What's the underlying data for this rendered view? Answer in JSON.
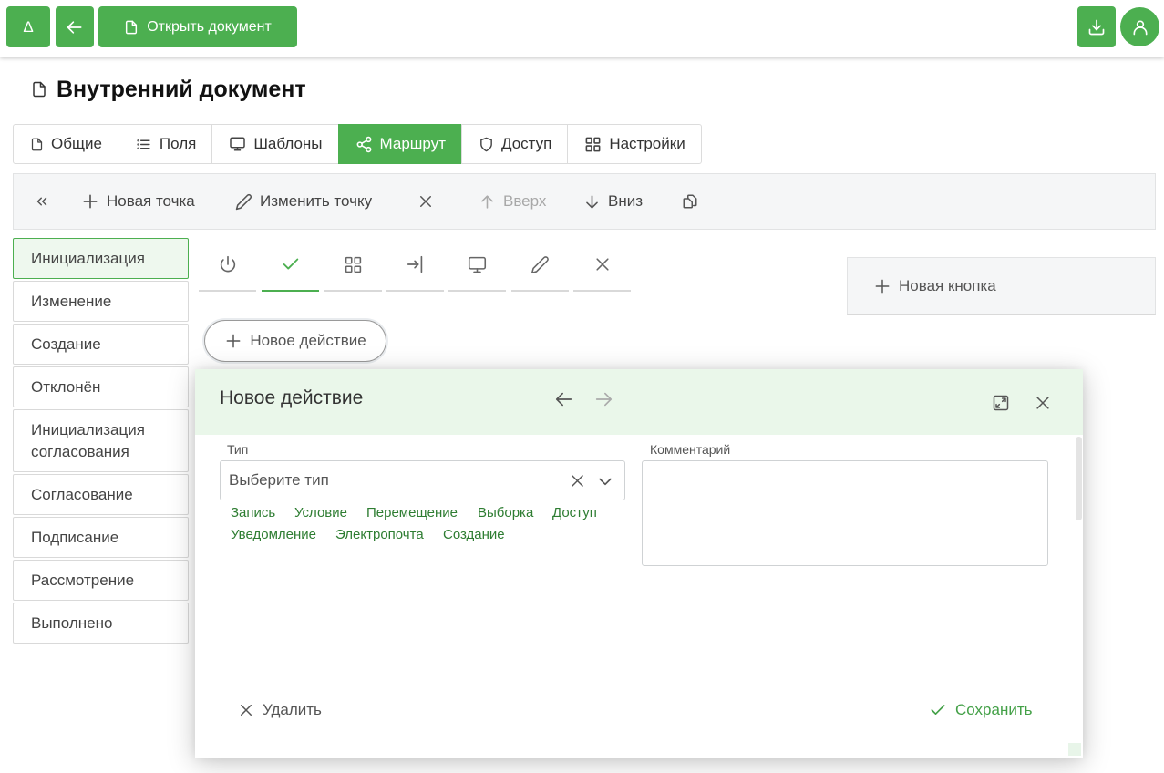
{
  "header": {
    "delta_label": "Δ",
    "open_document_label": "Открыть документ"
  },
  "page": {
    "title": "Внутренний документ"
  },
  "tabs": [
    {
      "label": "Общие",
      "icon": "file-icon"
    },
    {
      "label": "Поля",
      "icon": "list-icon"
    },
    {
      "label": "Шаблоны",
      "icon": "monitor-icon"
    },
    {
      "label": "Маршрут",
      "icon": "share-icon",
      "active": true
    },
    {
      "label": "Доступ",
      "icon": "shield-icon"
    },
    {
      "label": "Настройки",
      "icon": "grid-icon"
    }
  ],
  "toolbar": {
    "new_point": "Новая точка",
    "edit_point": "Изменить точку",
    "up": "Вверх",
    "down": "Вниз"
  },
  "points": [
    {
      "label": "Инициализация",
      "active": true
    },
    {
      "label": "Изменение"
    },
    {
      "label": "Создание"
    },
    {
      "label": "Отклонён"
    },
    {
      "label": "Инициализация согласования"
    },
    {
      "label": "Согласование"
    },
    {
      "label": "Подписание"
    },
    {
      "label": "Рассмотрение"
    },
    {
      "label": "Выполнено"
    }
  ],
  "icon_tabs": [
    "power-icon",
    "check-icon",
    "grid-icon",
    "login-icon",
    "monitor-icon",
    "pencil-icon",
    "close-icon"
  ],
  "actions": {
    "new_action": "Новое действие",
    "new_button": "Новая кнопка"
  },
  "dialog": {
    "title": "Новое действие",
    "type_label": "Тип",
    "type_placeholder": "Выберите тип",
    "comment_label": "Комментарий",
    "type_options": [
      "Запись",
      "Условие",
      "Перемещение",
      "Выборка",
      "Доступ",
      "Уведомление",
      "Электропочта",
      "Создание"
    ],
    "delete_label": "Удалить",
    "save_label": "Сохранить"
  },
  "colors": {
    "accent": "#4caf50",
    "accent_dark": "#43a047",
    "dialog_header_bg": "#eaf7ea",
    "toolbar_bg": "#f5f6f7"
  }
}
